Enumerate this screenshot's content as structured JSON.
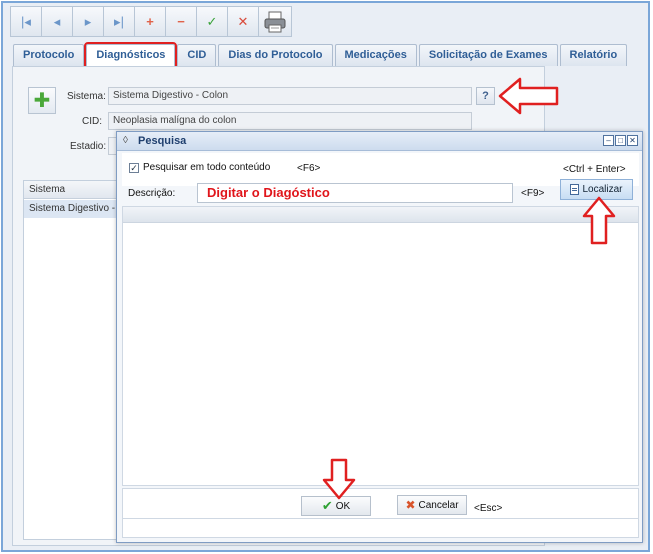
{
  "toolbar": {
    "buttons": [
      {
        "name": "first",
        "glyph": "|◂"
      },
      {
        "name": "prev",
        "glyph": "◂"
      },
      {
        "name": "next",
        "glyph": "▸"
      },
      {
        "name": "last",
        "glyph": "▸|"
      },
      {
        "name": "add",
        "glyph": "+"
      },
      {
        "name": "remove",
        "glyph": "−"
      },
      {
        "name": "confirm",
        "glyph": "✓"
      },
      {
        "name": "cancel",
        "glyph": "✕"
      },
      {
        "name": "print",
        "glyph": "🖨"
      }
    ]
  },
  "tabs": [
    {
      "label": "Protocolo",
      "active": false
    },
    {
      "label": "Diagnósticos",
      "active": true
    },
    {
      "label": "CID",
      "active": false
    },
    {
      "label": "Dias do Protocolo",
      "active": false
    },
    {
      "label": "Medicações",
      "active": false
    },
    {
      "label": "Solicitação de Exames",
      "active": false
    },
    {
      "label": "Relatório",
      "active": false
    }
  ],
  "form": {
    "sistema_label": "Sistema:",
    "sistema_value": "Sistema Digestivo - Colon",
    "cid_label": "CID:",
    "cid_value": "Neoplasia malígna do colon",
    "estadio_label": "Estadio:",
    "help_glyph": "?"
  },
  "grid": {
    "header": "Sistema",
    "rows": [
      "Sistema Digestivo - Colon"
    ]
  },
  "dialog": {
    "title": "Pesquisa",
    "checkbox_label": "Pesquisar em todo conteúdo",
    "checkbox_checked": true,
    "f6_hint": "<F6>",
    "ctrl_enter_hint": "<Ctrl + Enter>",
    "descricao_label": "Descrição:",
    "descricao_value": "Digitar o Diagóstico",
    "f9_hint": "<F9>",
    "localizar_label": "Localizar",
    "ok_label": "OK",
    "cancelar_label": "Cancelar",
    "esc_hint": "<Esc>"
  },
  "colors": {
    "annotation_red": "#e02020",
    "tab_text": "#2f5e96",
    "frame_blue": "#7aa6d8"
  }
}
